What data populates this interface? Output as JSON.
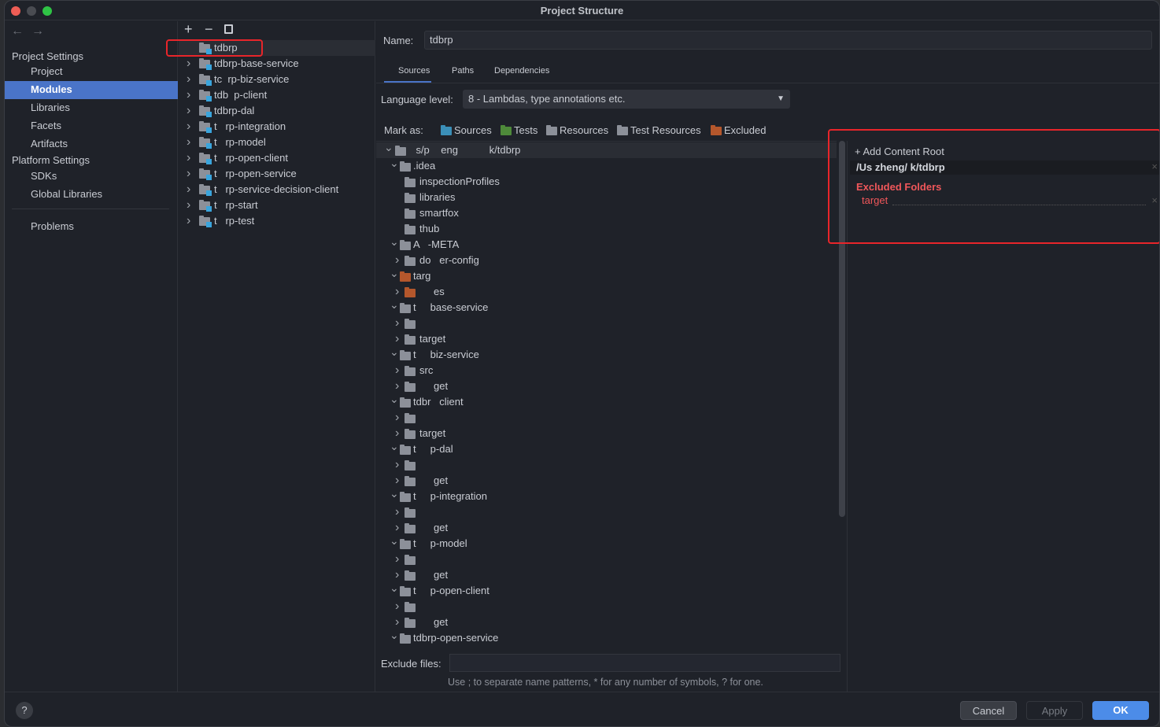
{
  "window": {
    "title": "Project Structure"
  },
  "sidebar": {
    "items": [
      {
        "label": "Project Settings",
        "type": "header"
      },
      {
        "label": "Project"
      },
      {
        "label": "Modules",
        "selected": true
      },
      {
        "label": "Libraries"
      },
      {
        "label": "Facets"
      },
      {
        "label": "Artifacts"
      },
      {
        "label": "Platform Settings",
        "type": "header"
      },
      {
        "label": "SDKs"
      },
      {
        "label": "Global Libraries"
      },
      {
        "label": "Problems"
      }
    ]
  },
  "modules": {
    "toolbar": {
      "add": "+",
      "remove": "−",
      "copy": "copy-icon"
    },
    "items": [
      "tdbrp",
      "tdbrp-base-service",
      "tc  rp-biz-service",
      "tdb  p-client",
      "tdbrp-dal",
      "t   rp-integration",
      "t   rp-model",
      "t   rp-open-client",
      "t   rp-open-service",
      "t   rp-service-decision-client",
      "t   rp-start",
      "t   rp-test"
    ]
  },
  "main": {
    "name_label": "Name:",
    "name_value": "tdbrp",
    "tabs": [
      "Sources",
      "Paths",
      "Dependencies"
    ],
    "active_tab": "Sources",
    "language_label": "Language level:",
    "language_value": "8 - Lambdas, type annotations etc.",
    "mark_as_label": "Mark as:",
    "mark_as": [
      {
        "label": "Sources",
        "color": "#3b8fb8"
      },
      {
        "label": "Tests",
        "color": "#4e8a3a"
      },
      {
        "label": "Resources",
        "color": "#8c9099"
      },
      {
        "label": "Test Resources",
        "color": "#8c9099"
      },
      {
        "label": "Excluded",
        "color": "#b4572c"
      }
    ],
    "tree": [
      {
        "l": 0,
        "o": 1,
        "t": "    s/p    eng           k/tdbrp"
      },
      {
        "l": 1,
        "o": 1,
        "t": ".idea"
      },
      {
        "l": 2,
        "leaf": 1,
        "t": "inspectionProfiles"
      },
      {
        "l": 2,
        "leaf": 1,
        "t": "libraries"
      },
      {
        "l": 2,
        "leaf": 1,
        "t": "smartfox"
      },
      {
        "l": 2,
        "leaf": 1,
        "t": "thub"
      },
      {
        "l": 1,
        "o": 1,
        "t": "A   -META"
      },
      {
        "l": 2,
        "t": "do   er-config"
      },
      {
        "l": 1,
        "o": 1,
        "t": "targ",
        "ex": 1
      },
      {
        "l": 2,
        "t": "     es",
        "ex": 1
      },
      {
        "l": 1,
        "o": 1,
        "t": "t     base-service"
      },
      {
        "l": 2,
        "t": ""
      },
      {
        "l": 2,
        "t": "target"
      },
      {
        "l": 1,
        "o": 1,
        "t": "t     biz-service"
      },
      {
        "l": 2,
        "t": "src"
      },
      {
        "l": 2,
        "t": "     get"
      },
      {
        "l": 1,
        "o": 1,
        "t": "tdbr   client"
      },
      {
        "l": 2,
        "t": ""
      },
      {
        "l": 2,
        "t": "target"
      },
      {
        "l": 1,
        "o": 1,
        "t": "t     p-dal"
      },
      {
        "l": 2,
        "t": ""
      },
      {
        "l": 2,
        "t": "     get"
      },
      {
        "l": 1,
        "o": 1,
        "t": "t     p-integration"
      },
      {
        "l": 2,
        "t": ""
      },
      {
        "l": 2,
        "t": "     get"
      },
      {
        "l": 1,
        "o": 1,
        "t": "t     p-model"
      },
      {
        "l": 2,
        "t": ""
      },
      {
        "l": 2,
        "t": "     get"
      },
      {
        "l": 1,
        "o": 1,
        "t": "t     p-open-client"
      },
      {
        "l": 2,
        "t": ""
      },
      {
        "l": 2,
        "t": "     get"
      },
      {
        "l": 1,
        "o": 1,
        "t": "tdbrp-open-service"
      }
    ],
    "exclude_label": "Exclude files:",
    "exclude_value": "",
    "exclude_hint": "Use ; to separate name patterns, * for any number of symbols, ? for one."
  },
  "content_root": {
    "add_label": "Add Content Root",
    "path": "/Us         zheng/            k/tdbrp",
    "excluded_header": "Excluded Folders",
    "excluded": [
      "target"
    ],
    "accent": "#f0575a"
  },
  "footer": {
    "help": "?",
    "cancel": "Cancel",
    "apply": "Apply",
    "ok": "OK"
  }
}
